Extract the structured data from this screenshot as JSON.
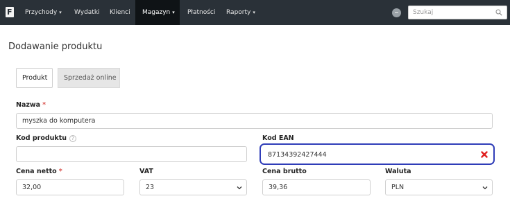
{
  "nav": {
    "items": [
      {
        "label": "Przychody",
        "caret": "▾"
      },
      {
        "label": "Wydatki"
      },
      {
        "label": "Klienci"
      },
      {
        "label": "Magazyn",
        "caret": "▾",
        "active": true
      },
      {
        "label": "Płatności"
      },
      {
        "label": "Raporty",
        "caret": "▾"
      }
    ],
    "search_placeholder": "Szukaj"
  },
  "page": {
    "title": "Dodawanie produktu",
    "tabs": [
      {
        "label": "Produkt",
        "active": true
      },
      {
        "label": "Sprzedaż online",
        "active": false
      }
    ]
  },
  "form": {
    "nazwa": {
      "label": "Nazwa",
      "required": "*",
      "value": "myszka do komputera"
    },
    "kod_produktu": {
      "label": "Kod produktu",
      "help": "?",
      "value": ""
    },
    "kod_ean": {
      "label": "Kod EAN",
      "value": "87134392427444"
    },
    "cena_netto": {
      "label": "Cena netto",
      "required": "*",
      "value": "32,00"
    },
    "vat": {
      "label": "VAT",
      "value": "23"
    },
    "cena_brutto": {
      "label": "Cena brutto",
      "value": "39,36"
    },
    "waluta": {
      "label": "Waluta",
      "value": "PLN"
    }
  },
  "colors": {
    "topbar": "#2a3138",
    "active_nav": "#0f1316",
    "focus_border": "#2f3db8",
    "required": "#d9534f",
    "clear_icon": "#e02020"
  },
  "icons": [
    "app-logo-icon",
    "caret-down-icon",
    "user-status-icon",
    "search-icon",
    "help-icon",
    "clear-icon",
    "chevron-down-icon"
  ]
}
